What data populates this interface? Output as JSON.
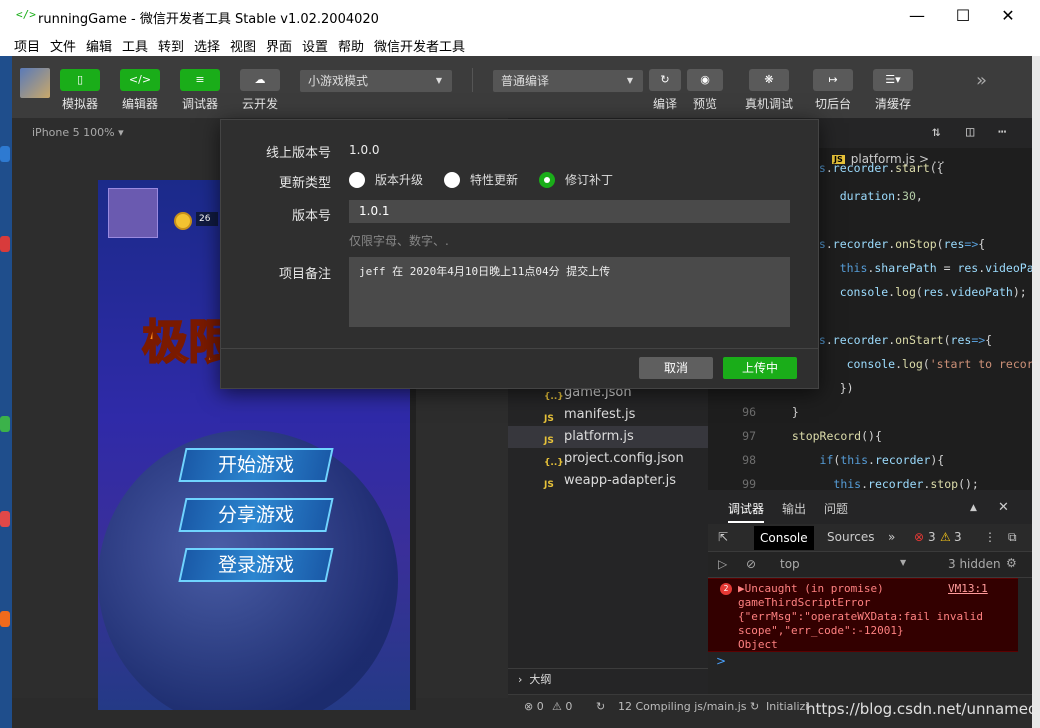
{
  "window": {
    "title": "runningGame - 微信开发者工具 Stable v1.02.2004020",
    "app_icon": "</>",
    "controls": [
      "minimize-icon",
      "maximize-icon",
      "close-icon"
    ]
  },
  "menu": [
    "项目",
    "文件",
    "编辑",
    "工具",
    "转到",
    "选择",
    "视图",
    "界面",
    "设置",
    "帮助",
    "微信开发者工具"
  ],
  "toolbar": {
    "buttons": [
      {
        "label": "模拟器",
        "icon": "phone-icon"
      },
      {
        "label": "编辑器",
        "icon": "code-icon"
      },
      {
        "label": "调试器",
        "icon": "debug-icon"
      },
      {
        "label": "云开发",
        "icon": "cloud-icon"
      }
    ],
    "mode_select": "小游戏模式",
    "compile_select": "普通编译",
    "actions": [
      {
        "label": "编译",
        "icon": "refresh-icon"
      },
      {
        "label": "预览",
        "icon": "eye-icon"
      },
      {
        "label": "真机调试",
        "icon": "bug-icon"
      },
      {
        "label": "切后台",
        "icon": "switch-icon"
      },
      {
        "label": "清缓存",
        "icon": "layers-icon"
      }
    ],
    "more_icon": "»"
  },
  "simulator": {
    "device": "iPhone 5 100% ▾",
    "game_buttons": [
      "开始游戏",
      "分享游戏",
      "登录游戏"
    ],
    "logo_text": "极限",
    "coin_value": "26"
  },
  "explorer": {
    "files": [
      {
        "icon": "{..}",
        "name": "game.json",
        "active": false
      },
      {
        "icon": "JS",
        "name": "manifest.js",
        "active": false
      },
      {
        "icon": "JS",
        "name": "platform.js",
        "active": true
      },
      {
        "icon": "{..}",
        "name": "project.config.json",
        "active": false
      },
      {
        "icon": "JS",
        "name": "weapp-adapter.js",
        "active": false
      }
    ],
    "outline_label": "大纲"
  },
  "editor": {
    "breadcrumb_file": "platform.js",
    "breadcrumb_more": "> …",
    "lines": [
      {
        "n": "",
        "parts": [
          [
            "kw",
            "is"
          ],
          [
            "pl",
            "."
          ],
          [
            "prop",
            "recorder"
          ],
          [
            "pl",
            "."
          ],
          [
            "fn",
            "start"
          ],
          [
            "pl",
            "({"
          ]
        ]
      },
      {
        "n": "",
        "parts": [
          [
            "pl",
            "    "
          ],
          [
            "prop",
            "duration"
          ],
          [
            "pl",
            ":"
          ],
          [
            "num",
            "30"
          ],
          [
            "pl",
            ","
          ]
        ]
      },
      {
        "n": "",
        "parts": []
      },
      {
        "n": "",
        "parts": [
          [
            "kw",
            "is"
          ],
          [
            "pl",
            "."
          ],
          [
            "prop",
            "recorder"
          ],
          [
            "pl",
            "."
          ],
          [
            "fn",
            "onStop"
          ],
          [
            "pl",
            "("
          ],
          [
            "prop",
            "res"
          ],
          [
            "kw",
            "=>"
          ],
          [
            "pl",
            "{"
          ]
        ]
      },
      {
        "n": "",
        "parts": [
          [
            "pl",
            "    "
          ],
          [
            "kw",
            "this"
          ],
          [
            "pl",
            "."
          ],
          [
            "prop",
            "sharePath"
          ],
          [
            "pl",
            " = "
          ],
          [
            "prop",
            "res"
          ],
          [
            "pl",
            "."
          ],
          [
            "prop",
            "videoPath"
          ]
        ]
      },
      {
        "n": "",
        "parts": [
          [
            "pl",
            "    "
          ],
          [
            "prop",
            "console"
          ],
          [
            "pl",
            "."
          ],
          [
            "fn",
            "log"
          ],
          [
            "pl",
            "("
          ],
          [
            "prop",
            "res"
          ],
          [
            "pl",
            "."
          ],
          [
            "prop",
            "videoPath"
          ],
          [
            "pl",
            ");"
          ]
        ]
      },
      {
        "n": "",
        "parts": []
      },
      {
        "n": "",
        "parts": [
          [
            "kw",
            "is"
          ],
          [
            "pl",
            "."
          ],
          [
            "prop",
            "recorder"
          ],
          [
            "pl",
            "."
          ],
          [
            "fn",
            "onStart"
          ],
          [
            "pl",
            "("
          ],
          [
            "prop",
            "res"
          ],
          [
            "kw",
            "=>"
          ],
          [
            "pl",
            "{"
          ]
        ]
      },
      {
        "n": "",
        "parts": [
          [
            "pl",
            "     "
          ],
          [
            "prop",
            "console"
          ],
          [
            "pl",
            "."
          ],
          [
            "fn",
            "log"
          ],
          [
            "pl",
            "("
          ],
          [
            "str",
            "'start to record'"
          ]
        ]
      },
      {
        "n": "",
        "parts": [
          [
            "pl",
            "    })"
          ]
        ]
      },
      {
        "n": "96",
        "parts": [
          [
            "pl",
            "  }"
          ]
        ]
      },
      {
        "n": "97",
        "parts": [
          [
            "pl",
            "  "
          ],
          [
            "fn",
            "stopRecord"
          ],
          [
            "pl",
            "(){"
          ]
        ]
      },
      {
        "n": "98",
        "parts": [
          [
            "pl",
            "      "
          ],
          [
            "kw",
            "if"
          ],
          [
            "pl",
            "("
          ],
          [
            "kw",
            "this"
          ],
          [
            "pl",
            "."
          ],
          [
            "prop",
            "recorder"
          ],
          [
            "pl",
            "){"
          ]
        ]
      },
      {
        "n": "99",
        "parts": [
          [
            "pl",
            "        "
          ],
          [
            "kw",
            "this"
          ],
          [
            "pl",
            "."
          ],
          [
            "prop",
            "recorder"
          ],
          [
            "pl",
            "."
          ],
          [
            "fn",
            "stop"
          ],
          [
            "pl",
            "();"
          ]
        ]
      }
    ]
  },
  "console": {
    "panel_tabs": [
      "调试器",
      "输出",
      "问题"
    ],
    "dev_tabs": [
      "Console",
      "Sources"
    ],
    "error_count": "3",
    "warning_count": "3",
    "context": "top",
    "hidden": "3 hidden",
    "error": {
      "count": "2",
      "lines": [
        "▶Uncaught (in promise)",
        "gameThirdScriptError",
        "{\"errMsg\":\"operateWXData:fail invalid",
        "scope\",\"err_code\":-12001}",
        "Object"
      ],
      "location": "VM13:1"
    },
    "prompt": ">"
  },
  "statusbar": {
    "errors": "⊗ 0",
    "warnings": "⚠ 0",
    "compiling": "12 Compiling js/main.js",
    "init": "Initializi"
  },
  "watermark": "https://blog.csdn.net/unnamedzc",
  "dialog": {
    "online_version_label": "线上版本号",
    "online_version": "1.0.0",
    "update_type_label": "更新类型",
    "update_types": [
      "版本升级",
      "特性更新",
      "修订补丁"
    ],
    "selected_update": 2,
    "version_label": "版本号",
    "version_value": "1.0.1",
    "version_hint": "仅限字母、数字、.",
    "note_label": "项目备注",
    "note_value": "jeff 在 2020年4月10日晚上11点04分 提交上传",
    "cancel": "取消",
    "upload": "上传中"
  },
  "colors": {
    "accent": "#1aad19",
    "error_bg": "#330000"
  }
}
